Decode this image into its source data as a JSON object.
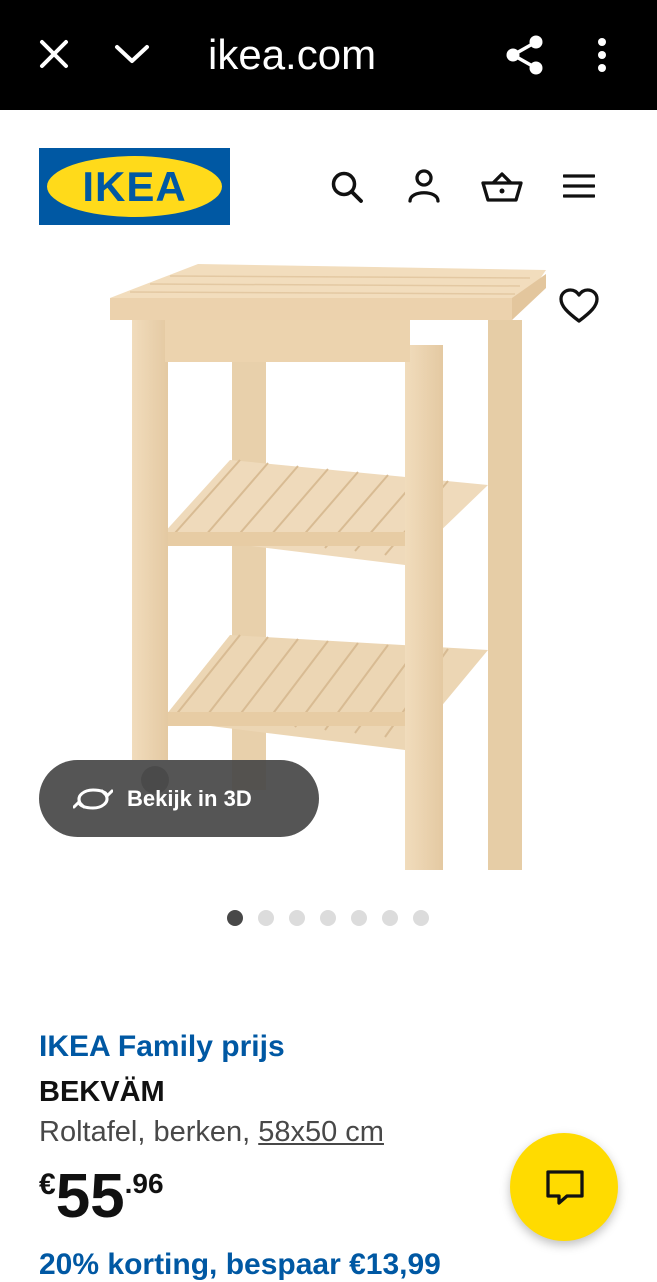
{
  "browser": {
    "url": "ikea.com",
    "icons": [
      "close-icon",
      "chevron-down-icon",
      "share-icon",
      "more-vertical-icon"
    ]
  },
  "header": {
    "logo_text": "IKEA",
    "icons": [
      "search-icon",
      "account-icon",
      "basket-icon",
      "menu-icon"
    ]
  },
  "gallery": {
    "view_3d_label": "Bekijk in 3D",
    "image_count": 7,
    "active_index": 0
  },
  "product": {
    "family_price_label": "IKEA Family prijs",
    "name": "BEKVÄM",
    "description": "Roltafel, berken,",
    "size": "58x50 cm",
    "price_currency": "€",
    "price_integer": "55",
    "price_decimal": ".96",
    "discount_text": "20% korting, bespaar €13,99"
  },
  "colors": {
    "ikea_blue": "#0058a3",
    "ikea_yellow": "#ffda1a",
    "chat_yellow": "#ffdb00"
  }
}
